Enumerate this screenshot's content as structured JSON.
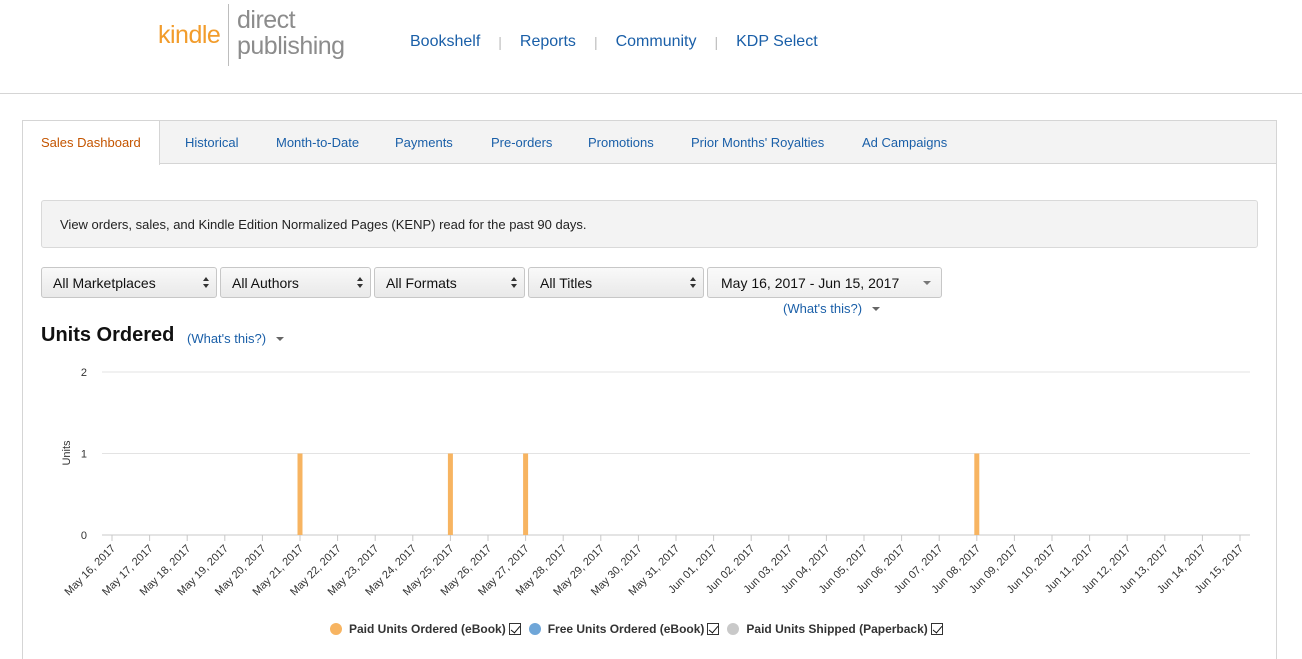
{
  "header": {
    "logo_kindle": "kindle",
    "logo_direct": "direct",
    "logo_publishing": "publishing",
    "nav": [
      "Bookshelf",
      "Reports",
      "Community",
      "KDP Select"
    ]
  },
  "tabs": [
    "Sales Dashboard",
    "Historical",
    "Month-to-Date",
    "Payments",
    "Pre-orders",
    "Promotions",
    "Prior Months' Royalties",
    "Ad Campaigns"
  ],
  "info_text": "View orders, sales, and Kindle Edition Normalized Pages (KENP) read for the past 90 days.",
  "filters": {
    "marketplace": "All Marketplaces",
    "authors": "All Authors",
    "formats": "All Formats",
    "titles": "All Titles",
    "date_range": "May 16, 2017 - Jun 15, 2017",
    "whats_this": "(What's this?)"
  },
  "section": {
    "title": "Units Ordered",
    "whats_this": "(What's this?)"
  },
  "colors": {
    "paid_ebook": "#f7b461",
    "free_ebook": "#6fa6d8",
    "paperback": "#c9c9c9",
    "link": "#1a5fa8",
    "active_tab": "#c45500"
  },
  "chart_data": {
    "type": "bar",
    "ylabel": "Units",
    "ylim": [
      0,
      2
    ],
    "yticks": [
      0,
      1,
      2
    ],
    "categories": [
      "May 16, 2017",
      "May 17, 2017",
      "May 18, 2017",
      "May 19, 2017",
      "May 20, 2017",
      "May 21, 2017",
      "May 22, 2017",
      "May 23, 2017",
      "May 24, 2017",
      "May 25, 2017",
      "May 26, 2017",
      "May 27, 2017",
      "May 28, 2017",
      "May 29, 2017",
      "May 30, 2017",
      "May 31, 2017",
      "Jun 01, 2017",
      "Jun 02, 2017",
      "Jun 03, 2017",
      "Jun 04, 2017",
      "Jun 05, 2017",
      "Jun 06, 2017",
      "Jun 07, 2017",
      "Jun 08, 2017",
      "Jun 09, 2017",
      "Jun 10, 2017",
      "Jun 11, 2017",
      "Jun 12, 2017",
      "Jun 13, 2017",
      "Jun 14, 2017",
      "Jun 15, 2017"
    ],
    "series": [
      {
        "name": "Paid Units Ordered (eBook)",
        "color": "#f7b461",
        "checked": true,
        "values": [
          0,
          0,
          0,
          0,
          0,
          1,
          0,
          0,
          0,
          1,
          0,
          1,
          0,
          0,
          0,
          0,
          0,
          0,
          0,
          0,
          0,
          0,
          0,
          1,
          0,
          0,
          0,
          0,
          0,
          0,
          0
        ]
      },
      {
        "name": "Free Units Ordered (eBook)",
        "color": "#6fa6d8",
        "checked": true,
        "values": [
          0,
          0,
          0,
          0,
          0,
          0,
          0,
          0,
          0,
          0,
          0,
          0,
          0,
          0,
          0,
          0,
          0,
          0,
          0,
          0,
          0,
          0,
          0,
          0,
          0,
          0,
          0,
          0,
          0,
          0,
          0
        ]
      },
      {
        "name": "Paid Units Shipped (Paperback)",
        "color": "#c9c9c9",
        "checked": true,
        "values": [
          0,
          0,
          0,
          0,
          0,
          0,
          0,
          0,
          0,
          0,
          0,
          0,
          0,
          0,
          0,
          0,
          0,
          0,
          0,
          0,
          0,
          0,
          0,
          0,
          0,
          0,
          0,
          0,
          0,
          0,
          0
        ]
      }
    ],
    "grid": true,
    "legend": "bottom-center"
  }
}
